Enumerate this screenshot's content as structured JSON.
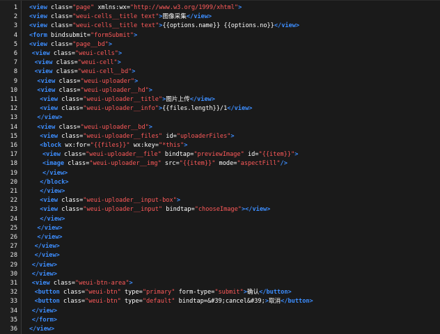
{
  "colors": {
    "background": "#1a1a1a",
    "gutter_bg": "#1e1e1e",
    "line_number": "#e8e8e8",
    "tag": "#3d8eff",
    "attribute": "#ffffff",
    "string": "#ff5a5a",
    "text": "#ffffff"
  },
  "lines": [
    {
      "n": "1",
      "indent": 0,
      "tokens": [
        [
          "tag",
          "<view"
        ],
        [
          "attr",
          " class="
        ],
        [
          "str",
          "\"page\""
        ],
        [
          "attr",
          " xmlns:wx="
        ],
        [
          "str",
          "\"http://www.w3.org/1999/xhtml\""
        ],
        [
          "tag",
          ">"
        ]
      ]
    },
    {
      "n": "2",
      "indent": 0,
      "tokens": [
        [
          "tag",
          "<view"
        ],
        [
          "attr",
          " class="
        ],
        [
          "str",
          "\"weui-cells__title text\""
        ],
        [
          "tag",
          ">"
        ],
        [
          "txt",
          "图像采集"
        ],
        [
          "tag",
          "</view>"
        ]
      ]
    },
    {
      "n": "3",
      "indent": 0,
      "tokens": [
        [
          "tag",
          "<view"
        ],
        [
          "attr",
          " class="
        ],
        [
          "str",
          "\"weui-cells__title text\""
        ],
        [
          "tag",
          ">"
        ],
        [
          "txt",
          "{{options.name}} {{options.no}}"
        ],
        [
          "tag",
          "</view>"
        ]
      ]
    },
    {
      "n": "4",
      "indent": 0,
      "tokens": [
        [
          "tag",
          "<form"
        ],
        [
          "attr",
          " bindsubmit="
        ],
        [
          "str",
          "\"formSubmit\""
        ],
        [
          "tag",
          ">"
        ]
      ]
    },
    {
      "n": "5",
      "indent": 0,
      "tokens": [
        [
          "tag",
          "<view"
        ],
        [
          "attr",
          " class="
        ],
        [
          "str",
          "\"page__bd\""
        ],
        [
          "tag",
          ">"
        ]
      ]
    },
    {
      "n": "6",
      "indent": 1,
      "tokens": [
        [
          "tag",
          "<view"
        ],
        [
          "attr",
          " class="
        ],
        [
          "str",
          "\"weui-cells\""
        ],
        [
          "tag",
          ">"
        ]
      ]
    },
    {
      "n": "7",
      "indent": 2,
      "tokens": [
        [
          "tag",
          "<view"
        ],
        [
          "attr",
          " class="
        ],
        [
          "str",
          "\"weui-cell\""
        ],
        [
          "tag",
          ">"
        ]
      ]
    },
    {
      "n": "8",
      "indent": 2,
      "tokens": [
        [
          "tag",
          "<view"
        ],
        [
          "attr",
          " class="
        ],
        [
          "str",
          "\"weui-cell__bd\""
        ],
        [
          "tag",
          ">"
        ]
      ]
    },
    {
      "n": "9",
      "indent": 3,
      "tokens": [
        [
          "tag",
          "<view"
        ],
        [
          "attr",
          " class="
        ],
        [
          "str",
          "\"weui-uploader\""
        ],
        [
          "tag",
          ">"
        ]
      ]
    },
    {
      "n": "10",
      "indent": 3,
      "tokens": [
        [
          "tag",
          "<view"
        ],
        [
          "attr",
          " class="
        ],
        [
          "str",
          "\"weui-uploader__hd\""
        ],
        [
          "tag",
          ">"
        ]
      ]
    },
    {
      "n": "11",
      "indent": 4,
      "tokens": [
        [
          "tag",
          "<view"
        ],
        [
          "attr",
          " class="
        ],
        [
          "str",
          "\"weui-uploader__title\""
        ],
        [
          "tag",
          ">"
        ],
        [
          "txt",
          "图片上传"
        ],
        [
          "tag",
          "</view>"
        ]
      ]
    },
    {
      "n": "12",
      "indent": 4,
      "tokens": [
        [
          "tag",
          "<view"
        ],
        [
          "attr",
          " class="
        ],
        [
          "str",
          "\"weui-uploader__info\""
        ],
        [
          "tag",
          ">"
        ],
        [
          "txt",
          "{{files.length}}/1"
        ],
        [
          "tag",
          "</view>"
        ]
      ]
    },
    {
      "n": "13",
      "indent": 3,
      "tokens": [
        [
          "tag",
          "</view>"
        ]
      ]
    },
    {
      "n": "14",
      "indent": 3,
      "tokens": [
        [
          "tag",
          "<view"
        ],
        [
          "attr",
          " class="
        ],
        [
          "str",
          "\"weui-uploader__bd\""
        ],
        [
          "tag",
          ">"
        ]
      ]
    },
    {
      "n": "15",
      "indent": 4,
      "tokens": [
        [
          "tag",
          "<view"
        ],
        [
          "attr",
          " class="
        ],
        [
          "str",
          "\"weui-uploader__files\""
        ],
        [
          "attr",
          " id="
        ],
        [
          "str",
          "\"uploaderFiles\""
        ],
        [
          "tag",
          ">"
        ]
      ]
    },
    {
      "n": "16",
      "indent": 4,
      "tokens": [
        [
          "tag",
          "<block"
        ],
        [
          "attr",
          " wx:for="
        ],
        [
          "str",
          "\"{{files}}\""
        ],
        [
          "attr",
          " wx:key="
        ],
        [
          "str",
          "\"*this\""
        ],
        [
          "tag",
          ">"
        ]
      ]
    },
    {
      "n": "17",
      "indent": 5,
      "tokens": [
        [
          "tag",
          "<view"
        ],
        [
          "attr",
          " class="
        ],
        [
          "str",
          "\"weui-uploader__file\""
        ],
        [
          "attr",
          " bindtap="
        ],
        [
          "str",
          "\"previewImage\""
        ],
        [
          "attr",
          " id="
        ],
        [
          "str",
          "\"{{item}}\""
        ],
        [
          "tag",
          ">"
        ]
      ]
    },
    {
      "n": "18",
      "indent": 5,
      "tokens": [
        [
          "tag",
          "<image"
        ],
        [
          "attr",
          " class="
        ],
        [
          "str",
          "\"weui-uploader__img\""
        ],
        [
          "attr",
          " src="
        ],
        [
          "str",
          "\"{{item}}\""
        ],
        [
          "attr",
          " mode="
        ],
        [
          "str",
          "\"aspectFill\""
        ],
        [
          "tag",
          "/>"
        ]
      ]
    },
    {
      "n": "19",
      "indent": 5,
      "tokens": [
        [
          "tag",
          "</view>"
        ]
      ]
    },
    {
      "n": "20",
      "indent": 4,
      "tokens": [
        [
          "tag",
          "</block>"
        ]
      ]
    },
    {
      "n": "21",
      "indent": 4,
      "tokens": [
        [
          "tag",
          "</view>"
        ]
      ]
    },
    {
      "n": "22",
      "indent": 4,
      "tokens": [
        [
          "tag",
          "<view"
        ],
        [
          "attr",
          " class="
        ],
        [
          "str",
          "\"weui-uploader__input-box\""
        ],
        [
          "tag",
          ">"
        ]
      ]
    },
    {
      "n": "23",
      "indent": 4,
      "tokens": [
        [
          "tag",
          "<view"
        ],
        [
          "attr",
          " class="
        ],
        [
          "str",
          "\"weui-uploader__input\""
        ],
        [
          "attr",
          " bindtap="
        ],
        [
          "str",
          "\"chooseImage\""
        ],
        [
          "tag",
          "></view>"
        ]
      ]
    },
    {
      "n": "24",
      "indent": 4,
      "tokens": [
        [
          "tag",
          "</view>"
        ]
      ]
    },
    {
      "n": "25",
      "indent": 3,
      "tokens": [
        [
          "tag",
          "</view>"
        ]
      ]
    },
    {
      "n": "26",
      "indent": 3,
      "tokens": [
        [
          "tag",
          "</view>"
        ]
      ]
    },
    {
      "n": "27",
      "indent": 2,
      "tokens": [
        [
          "tag",
          "</view>"
        ]
      ]
    },
    {
      "n": "28",
      "indent": 2,
      "tokens": [
        [
          "tag",
          "</view>"
        ]
      ]
    },
    {
      "n": "29",
      "indent": 1,
      "tokens": [
        [
          "tag",
          "</view>"
        ]
      ]
    },
    {
      "n": "30",
      "indent": 1,
      "tokens": [
        [
          "tag",
          "</view>"
        ]
      ]
    },
    {
      "n": "31",
      "indent": 1,
      "tokens": [
        [
          "tag",
          "<view"
        ],
        [
          "attr",
          " class="
        ],
        [
          "str",
          "\"weui-btn-area\""
        ],
        [
          "tag",
          ">"
        ]
      ]
    },
    {
      "n": "32",
      "indent": 2,
      "tokens": [
        [
          "tag",
          "<button"
        ],
        [
          "attr",
          " class="
        ],
        [
          "str",
          "\"weui-btn\""
        ],
        [
          "attr",
          " type="
        ],
        [
          "str",
          "\"primary\""
        ],
        [
          "attr",
          " form-type="
        ],
        [
          "str",
          "\"submit\""
        ],
        [
          "tag",
          ">"
        ],
        [
          "txt",
          "确认"
        ],
        [
          "tag",
          "</button>"
        ]
      ]
    },
    {
      "n": "33",
      "indent": 2,
      "tokens": [
        [
          "tag",
          "<button"
        ],
        [
          "attr",
          " class="
        ],
        [
          "str",
          "\"weui-btn\""
        ],
        [
          "attr",
          " type="
        ],
        [
          "str",
          "\"default\""
        ],
        [
          "attr",
          " bindtap=&#39;cancel&#39;"
        ],
        [
          "tag",
          ">"
        ],
        [
          "txt",
          "取消"
        ],
        [
          "tag",
          "</button>"
        ]
      ]
    },
    {
      "n": "34",
      "indent": 1,
      "tokens": [
        [
          "tag",
          "</view>"
        ]
      ]
    },
    {
      "n": "35",
      "indent": 1,
      "tokens": [
        [
          "tag",
          "</form>"
        ]
      ]
    },
    {
      "n": "36",
      "indent": 0,
      "tokens": [
        [
          "tag",
          "</view>"
        ]
      ]
    }
  ]
}
